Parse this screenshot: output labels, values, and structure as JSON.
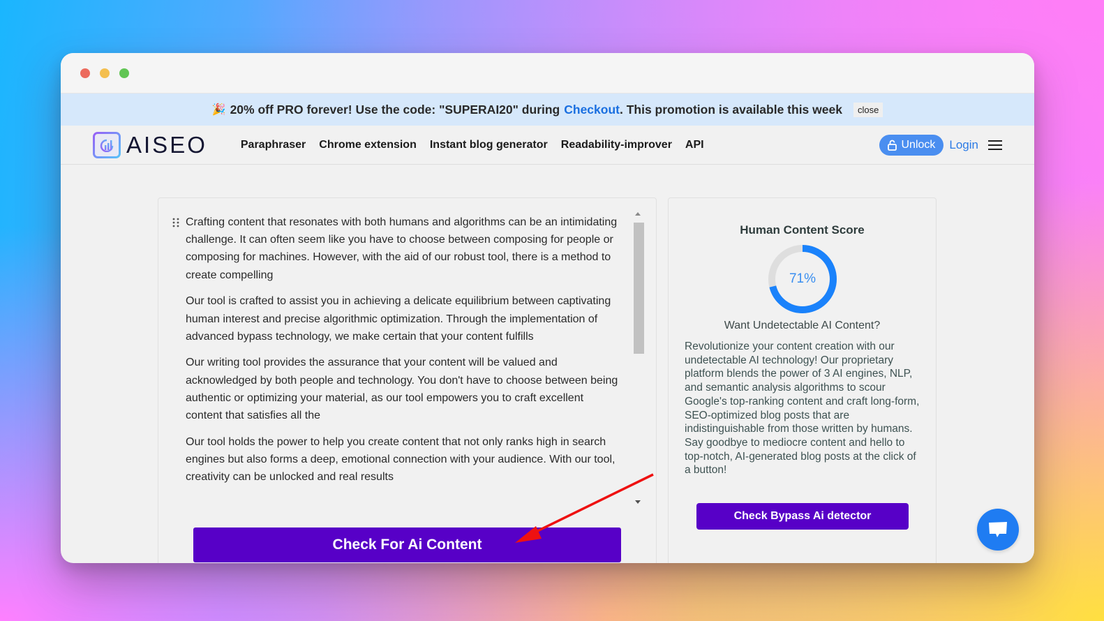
{
  "window": {
    "controls": [
      "close",
      "minimize",
      "maximize"
    ]
  },
  "promo_banner": {
    "icon": "party-popper-icon",
    "text_before": "20% off PRO forever! Use the code: \"SUPERAI20\" during",
    "link_label": "Checkout",
    "text_after": ". This promotion is available this week",
    "close_label": "close"
  },
  "nav": {
    "logo_text": "AISEO",
    "links": [
      {
        "label": "Paraphraser"
      },
      {
        "label": "Chrome extension"
      },
      {
        "label": "Instant blog generator"
      },
      {
        "label": "Readability-improver"
      },
      {
        "label": "API"
      }
    ],
    "unlock_label": "Unlock",
    "login_label": "Login",
    "menu_icon": "hamburger-icon"
  },
  "editor": {
    "paragraphs": [
      "Crafting content that resonates with both humans and algorithms can be an intimidating challenge. It can often seem like you have to choose between composing for people or composing for machines. However, with the aid of our robust tool, there is a method to create compelling",
      "Our tool is crafted to assist you in achieving a delicate equilibrium between captivating human interest and precise algorithmic optimization. Through the implementation of advanced bypass technology, we make certain that your content fulfills",
      "Our writing tool provides the assurance that your content will be valued and acknowledged by both people and technology. You don't have to choose between being authentic or optimizing your material, as our tool empowers you to craft excellent content that satisfies all the",
      "Our tool holds the power to help you create content that not only ranks high in search engines but also forms a deep, emotional connection with your audience. With our tool, creativity can be unlocked and real results"
    ],
    "check_button_label": "Check For Ai Content"
  },
  "score_panel": {
    "title": "Human Content Score",
    "score_percent": 71,
    "score_label": "71%",
    "colors": {
      "progress": "#1a82fb",
      "track": "#dedede"
    },
    "question": "Want Undetectable AI Content?",
    "description": "Revolutionize your content creation with our undetectable AI technology! Our proprietary platform blends the power of 3 AI engines, NLP, and semantic analysis algorithms to scour Google's top-ranking content and craft long-form, SEO-optimized blog posts that are indistinguishable from those written by humans. Say goodbye to mediocre content and hello to top-notch, AI-generated blog posts at the click of a button!",
    "bypass_button_label": "Check Bypass Ai detector"
  },
  "chat_widget": {
    "icon": "chat-bubble-icon"
  },
  "annotation": {
    "type": "red-arrow",
    "points_to": "Check For Ai Content",
    "color": "#ee1111"
  },
  "colors": {
    "primary_button": "#5700c7",
    "link": "#1a6fe0",
    "unlock": "#4a8ef0",
    "promo_bg": "#d6e8fb"
  }
}
